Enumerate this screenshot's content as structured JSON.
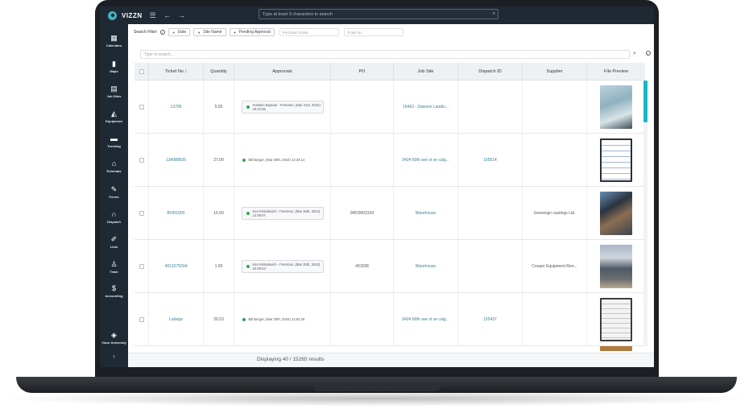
{
  "app": {
    "name": "VIZZN"
  },
  "topbar": {
    "search_placeholder": "Type at least 3 characters to search"
  },
  "sidebar": {
    "items": [
      {
        "label": "Calendars",
        "icon": "calendar-icon"
      },
      {
        "label": "Maps",
        "icon": "map-icon"
      },
      {
        "label": "Job Sites",
        "icon": "job-sites-icon"
      },
      {
        "label": "Equipment",
        "icon": "excavator-icon"
      },
      {
        "label": "Trucking",
        "icon": "truck-icon"
      },
      {
        "label": "Externals",
        "icon": "externals-icon"
      },
      {
        "label": "Forms",
        "icon": "forms-icon"
      },
      {
        "label": "Dispatch",
        "icon": "headset-icon"
      },
      {
        "label": "Lists",
        "icon": "list-icon"
      },
      {
        "label": "Team",
        "icon": "team-icon"
      },
      {
        "label": "Accounting",
        "icon": "dollar-icon"
      },
      {
        "label": "Vizzn University",
        "icon": "university-icon"
      }
    ]
  },
  "filters": {
    "label": "Search Filter:",
    "date": "Date",
    "site_name": "Site Name",
    "pending_approval": "Pending Approval",
    "purchase_order_placeholder": "Purchase Order",
    "ticket_no_placeholder": "Ticket No"
  },
  "search": {
    "placeholder": "Type to search..."
  },
  "table": {
    "columns": [
      "Ticket No",
      "Quantity",
      "Approvals",
      "PO",
      "Job Site",
      "Dispatch ID",
      "Supplier",
      "File Preview"
    ],
    "sort_icon": "↕",
    "rows": [
      {
        "ticket": "13799",
        "quantity": "5.00",
        "approval": "Hussein Bayram - Foreman, (Mar 21st, 2024) 15:13:35",
        "po": "",
        "job_site": "19463 - Dawson Landin...",
        "dispatch": "",
        "supplier": ""
      },
      {
        "ticket": "134988826",
        "quantity": "27.00",
        "approval": "Bill Borger, (Mar 29th, 2024) 14:34:14",
        "po": "",
        "job_site": "9424 60th ave st se calg...",
        "dispatch": "155514",
        "supplier": ""
      },
      {
        "ticket": "BOR1000",
        "quantity": "15.00",
        "approval": "Ken Kristalovich - Foreman, (Mar 15th, 2024) 12:49:07",
        "po": "0RD0003143",
        "job_site": "Warehouse",
        "dispatch": "",
        "supplier": "Sovereign castings Ltd."
      },
      {
        "ticket": "4013275004",
        "quantity": "1.00",
        "approval": "Ken Kristalovich - Foreman, (Mar 15th, 2024) 10:49:44",
        "po": "#81598",
        "job_site": "Warehouse",
        "dispatch": "",
        "supplier": "Cooper Equipment Ren..."
      },
      {
        "ticket": "Lafarge",
        "quantity": "26.53",
        "approval": "Bill Borger, (Mar 20th, 2024) 14:54:20",
        "po": "",
        "job_site": "9424 60th ave st se calg...",
        "dispatch": "155437",
        "supplier": ""
      }
    ]
  },
  "footer": {
    "text": "Displaying 40 / 15265 results"
  },
  "colors": {
    "sidebar_bg": "#1f2933",
    "accent": "#17b7c8",
    "link": "#3a7f95",
    "approved_dot": "#2fa84f"
  }
}
